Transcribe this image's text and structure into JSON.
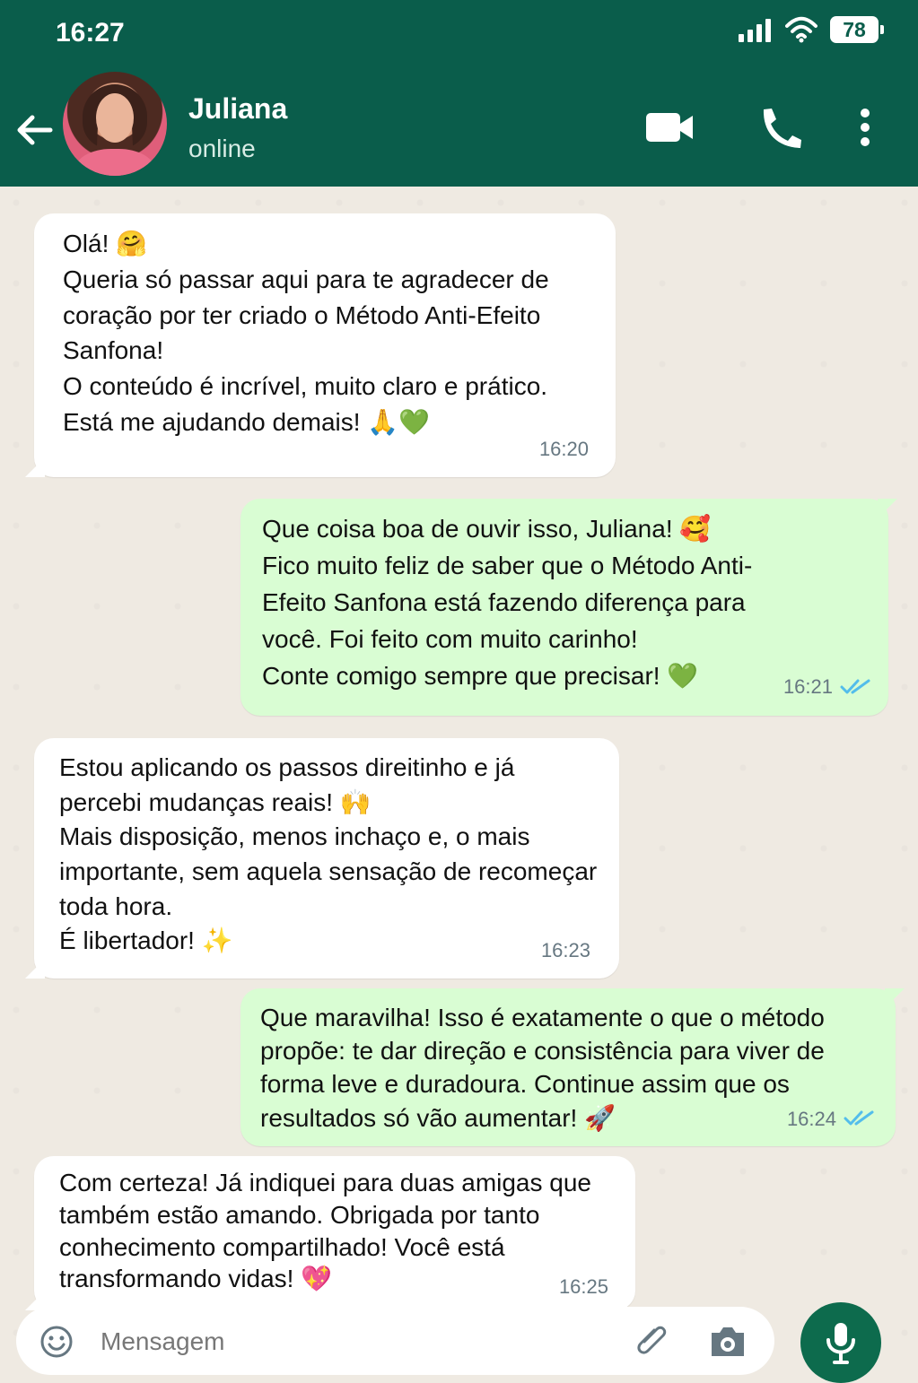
{
  "status": {
    "time": "16:27",
    "battery": "78",
    "icons": [
      "signal-icon",
      "wifi-icon",
      "battery-icon"
    ]
  },
  "header": {
    "name": "Juliana",
    "presence": "online",
    "actions": [
      "video-call-icon",
      "voice-call-icon",
      "more-icon"
    ]
  },
  "messages": [
    {
      "direction": "incoming",
      "lines": [
        "Olá! 🤗",
        "Queria só passar aqui para te agradecer de",
        "coração por ter criado o Método Anti-Efeito",
        "Sanfona!",
        "O conteúdo é incrível, muito claro e prático.",
        "Está me ajudando demais! 🙏💚"
      ],
      "time": "16:20"
    },
    {
      "direction": "outgoing",
      "lines": [
        "Que coisa boa de ouvir isso, Juliana! 🥰",
        "Fico muito feliz de saber que o Método Anti-",
        "Efeito Sanfona está fazendo diferença para",
        "você. Foi feito com muito carinho!",
        "Conte comigo sempre que precisar! 💚"
      ],
      "time": "16:21",
      "status": "read"
    },
    {
      "direction": "incoming",
      "lines": [
        "Estou aplicando os passos direitinho e já",
        "percebi mudanças reais! 🙌",
        "Mais disposição, menos inchaço e, o mais",
        "importante, sem aquela sensação de recomeçar",
        "toda hora.",
        "É libertador! ✨"
      ],
      "time": "16:23"
    },
    {
      "direction": "outgoing",
      "lines": [
        "Que maravilha! Isso é exatamente o que o método",
        "propõe: te dar direção e consistência para viver de",
        "forma leve e duradoura. Continue assim que os",
        "resultados só vão aumentar! 🚀"
      ],
      "time": "16:24",
      "status": "read"
    },
    {
      "direction": "incoming",
      "lines": [
        "Com certeza! Já indiquei para duas amigas que",
        "também estão amando. Obrigada por tanto",
        "conhecimento compartilhado! Você está",
        "transformando vidas! 💖"
      ],
      "time": "16:25"
    }
  ],
  "input": {
    "placeholder": "Mensagem",
    "icons": [
      "emoji-icon",
      "attachment-icon",
      "camera-icon",
      "microphone-icon"
    ]
  },
  "colors": {
    "header": "#0a5d4b",
    "chat_background": "#efeae2",
    "incoming_bubble": "#ffffff",
    "outgoing_bubble": "#d9fdd3",
    "read_ticks": "#53bdeb",
    "mic_button": "#0d6b4d"
  }
}
